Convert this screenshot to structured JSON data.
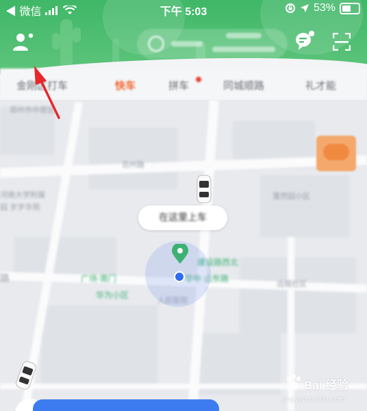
{
  "status_bar": {
    "carrier": "◀ 微信",
    "time": "下午 5:03",
    "battery": "53%"
  },
  "header": {
    "user_icon": "user-icon",
    "message_icon": "chat-bubble-icon",
    "scan_icon": "scan-icon",
    "pill_icon": "pin-circle-icon",
    "accent": "#3fb767"
  },
  "tabs": [
    {
      "label": "金刚区打车"
    },
    {
      "label": "快车",
      "active": true
    },
    {
      "label": "拼车"
    },
    {
      "label": "同城顺路"
    },
    {
      "label": "礼才能"
    }
  ],
  "map": {
    "pickup_hint": "在这里上车",
    "labels": [
      "郑州市中原区",
      "百州路",
      "河南大学附属",
      "园  岁岁华苑",
      "路",
      "蓬然园小区",
      "建设路 西北",
      "广场·南门",
      "华为小区",
      "远顺社区",
      "人民医院"
    ],
    "pickup_labels": [
      "建设路西北",
      "广场·南门",
      "华中 山东路"
    ]
  },
  "watermark": {
    "brand": "Bai 经验",
    "url": "jingyan.baidu.com"
  },
  "colors": {
    "active_tab": "#f3642f",
    "location_blue": "#2e6df0",
    "pickup_green": "#3db173",
    "annotation_red": "#e8262b"
  }
}
